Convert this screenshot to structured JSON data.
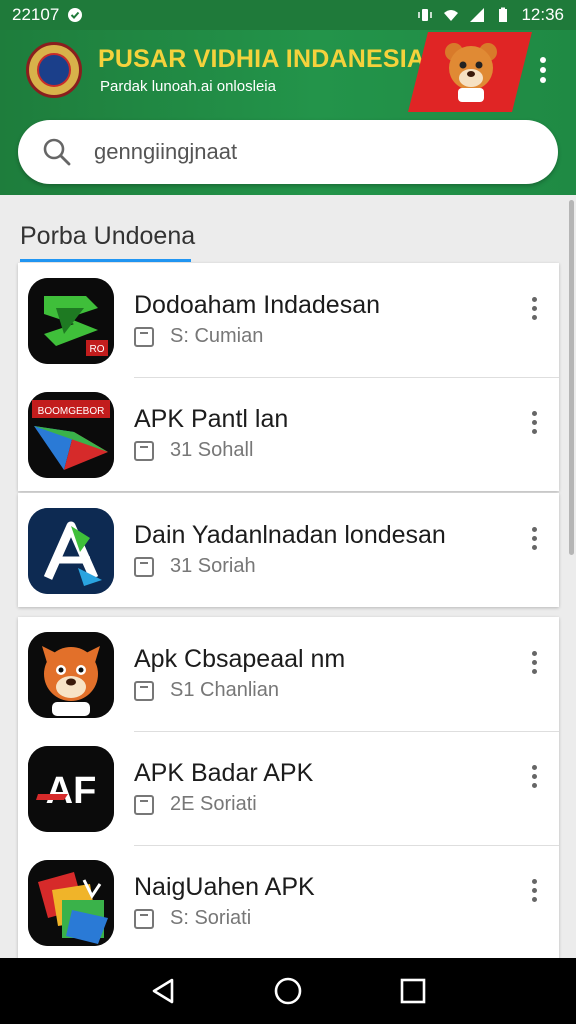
{
  "status_bar": {
    "time_left": "22107",
    "time_right": "12:36"
  },
  "header": {
    "title": "PUSAR VIDHIA INDANESIA",
    "subtitle": "Pardak lunoah.ai onlosleia",
    "accent_color": "#23944a",
    "title_color": "#f5d23c"
  },
  "search": {
    "placeholder": "genngiingjnaat",
    "value": ""
  },
  "section": {
    "title": "Porba Undoena",
    "underline_color": "#2196f3"
  },
  "apps": [
    {
      "title": "Dodoaham Indadesan",
      "meta": "S: Cumian",
      "icon": "green-arrow-app-icon"
    },
    {
      "title": "APK Pantl lan",
      "meta": "31 Sohall",
      "icon": "colorful-shapes-app-icon"
    },
    {
      "title": "Dain Yadanlnadan londesan",
      "meta": "31 Soriah",
      "icon": "triangle-a-app-icon"
    },
    {
      "title": "Apk Cbsapeaal nm",
      "meta": "S1 Chanlian",
      "icon": "tiger-mascot-app-icon"
    },
    {
      "title": "APK Badar APK",
      "meta": "2E Soriati",
      "icon": "af-logo-app-icon"
    },
    {
      "title": "NaigUahen APK",
      "meta": "S: Soriati",
      "icon": "colorful-folder-app-icon"
    }
  ],
  "icon_texts": {
    "app1_badge": "RO",
    "app2_banner": "BOOMGEBOR",
    "app5_letters": "AF"
  },
  "navigation": {
    "back": "back-icon",
    "home": "home-icon",
    "recents": "recents-icon"
  }
}
